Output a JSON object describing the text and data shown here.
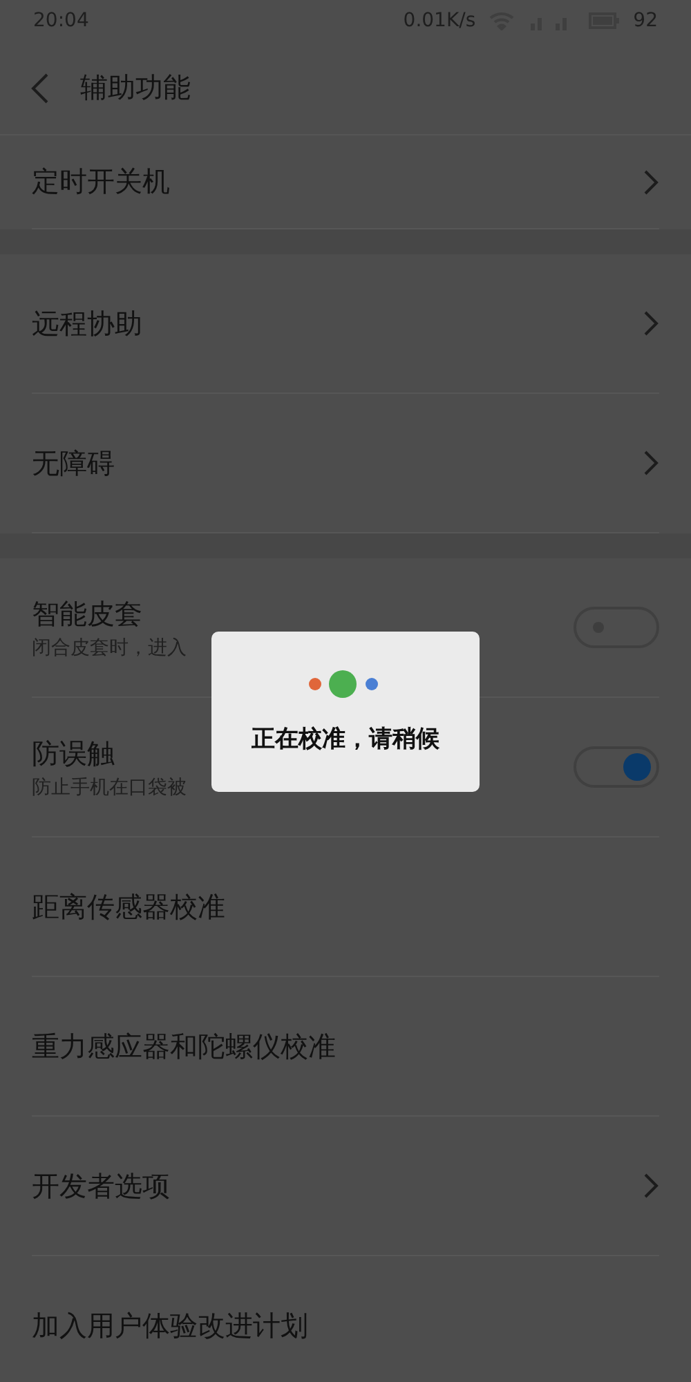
{
  "status_bar": {
    "time": "20:04",
    "net_speed": "0.01K/s",
    "battery": "92"
  },
  "header": {
    "title": "辅助功能"
  },
  "sections": [
    {
      "items": [
        {
          "kind": "link",
          "title": "定时开关机"
        }
      ]
    },
    {
      "items": [
        {
          "kind": "link",
          "title": "远程协助"
        },
        {
          "kind": "link",
          "title": "无障碍"
        }
      ]
    },
    {
      "items": [
        {
          "kind": "toggle",
          "title": "智能皮套",
          "subtitle": "闭合皮套时，进入",
          "on": false
        },
        {
          "kind": "toggle",
          "title": "防误触",
          "subtitle": "防止手机在口袋被",
          "on": true
        },
        {
          "kind": "plain",
          "title": "距离传感器校准"
        },
        {
          "kind": "plain",
          "title": "重力感应器和陀螺仪校准"
        },
        {
          "kind": "link",
          "title": "开发者选项"
        },
        {
          "kind": "plain",
          "title": "加入用户体验改进计划"
        }
      ]
    }
  ],
  "dialog": {
    "message": "正在校准，请稍候"
  }
}
